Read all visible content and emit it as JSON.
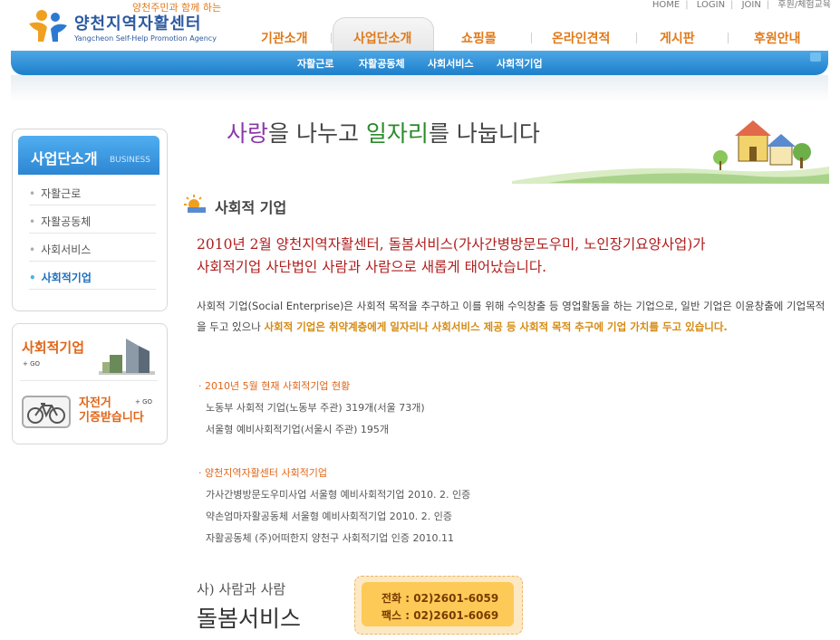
{
  "util_links": [
    "HOME",
    "LOGIN",
    "JOIN",
    "후원/체험교육"
  ],
  "logo": {
    "tagline": "양천주민과 함께 하는",
    "name": "양천지역자활센터",
    "english": "Yangcheon Self-Help Promotion Agency"
  },
  "main_nav": [
    "기관소개",
    "사업단소개",
    "쇼핑몰",
    "온라인견적",
    "게시판",
    "후원안내"
  ],
  "sub_nav": [
    "자활근로",
    "자활공동체",
    "사회서비스",
    "사회적기업"
  ],
  "banner": {
    "slogan_a": "사랑",
    "slogan_b": "을 나누고 ",
    "slogan_c": "일자리",
    "slogan_d": "를 나눕니다"
  },
  "sidebar": {
    "title": "사업단소개",
    "title_en": "BUSINESS",
    "items": [
      "자활근로",
      "자활공동체",
      "사회서비스",
      "사회적기업"
    ]
  },
  "promo": {
    "social_title": "사회적기업",
    "go": "GO",
    "bike_line1": "자전거",
    "bike_line2": "기증받습니다"
  },
  "page_title": "사회적 기업",
  "headline": {
    "line1": "2010년 2월 양천지역자활센터, 돌봄서비스(가사간병방문도우미, 노인장기요양사업)가",
    "line2": "사회적기업 사단법인 사람과 사람으로 새롭게 태어났습니다."
  },
  "intro": {
    "part1": "사회적 기업(Social Enterprise)은 사회적 목적을 추구하고 이를 위해 수익창출 등 영업활동을 하는 기업으로, 일반 기업은 이윤창출에 기업목적을 두고 있으나 ",
    "highlight": "사회적 기업은 취약계층에게 일자리나 사회서비스 제공 등 사회적 목적 추구에 기업 가치를 두고 있습니다."
  },
  "section1": {
    "heading": "· 2010년 5월 현재 사회적기업 현황",
    "lines": [
      "노동부 사회적 기업(노동부 주관) 319개(서울 73개)",
      "서울형 예비사회적기업(서울시 주관) 195개"
    ]
  },
  "section2": {
    "heading": "· 양천지역자활센터 사회적기업",
    "lines": [
      "가사간병방문도우미사업 서울형 예비사회적기업 2010. 2. 인증",
      "약손엄마자활공동체 서울형 예비사회적기업 2010. 2. 인증",
      "자활공동체 (주)어떠한지 양천구 사회적기업 인증 2010.11"
    ]
  },
  "care": {
    "small": "사) 사람과 사람",
    "big": "돌봄서비스"
  },
  "contact": {
    "phone": "전화 : 02)2601-6059",
    "fax": "팩스 : 02)2601-6069"
  },
  "colors": {
    "brand_blue": "#2c5aa0",
    "nav_orange": "#e07a1a",
    "subbar_blue": "#1d7fcb",
    "headline_red": "#b01c1c",
    "highlight_orange": "#d58a10"
  }
}
